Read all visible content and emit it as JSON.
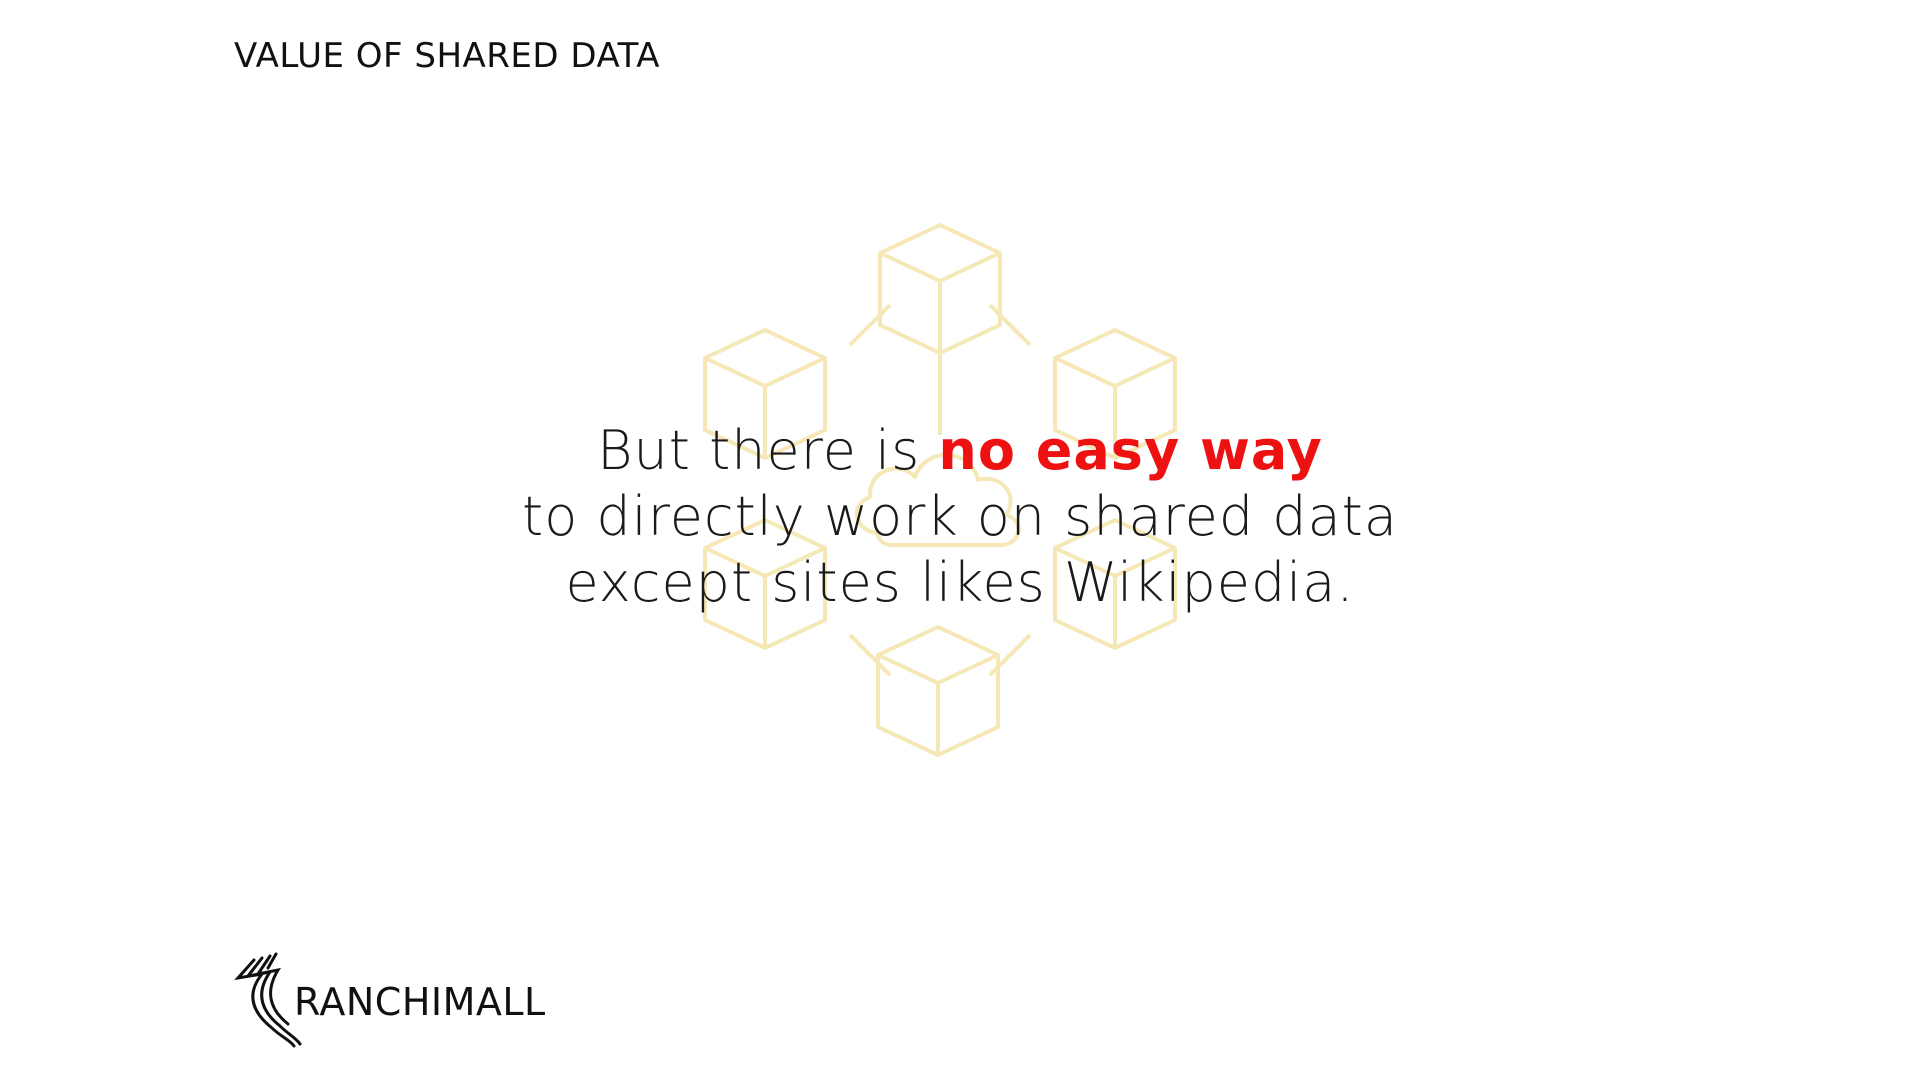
{
  "slide": {
    "title": "VALUE OF SHARED DATA",
    "message": {
      "line1_prefix": "But there is ",
      "line1_highlight": "no easy way",
      "line2": "to directly work on shared data",
      "line3": "except sites likes Wikipedia."
    },
    "logo_text": "RANCHIMALL"
  },
  "colors": {
    "background": "#ffffff",
    "text": "#1a1a1a",
    "highlight": "#ee1111",
    "graphic": "#f5e7b6"
  },
  "icons": {
    "background_graphic": "blockchain-network-icon",
    "logo_mark": "ranchimall-logo-icon"
  }
}
